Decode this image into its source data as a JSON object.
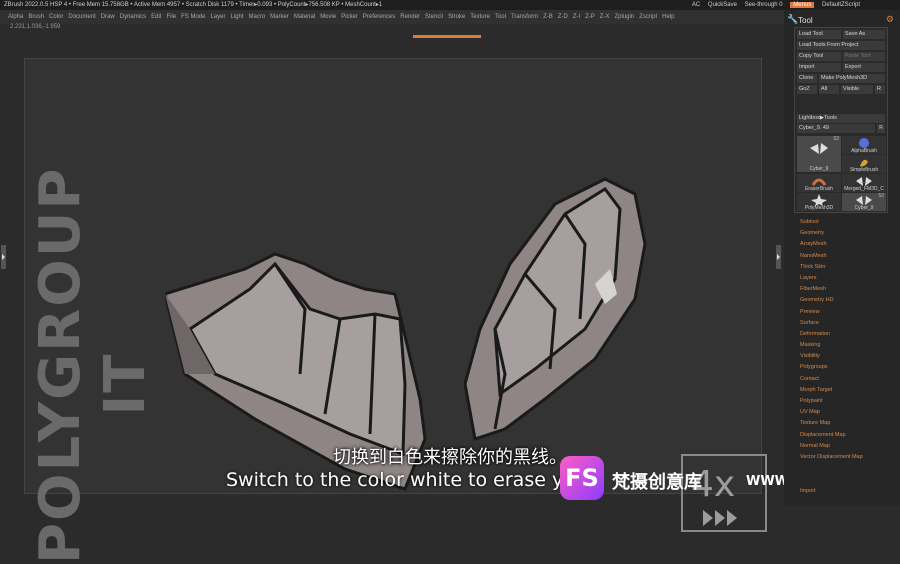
{
  "titlebar": {
    "left_text": "ZBrush 2022.0.5    HSP 4    • Free Mem 15.758GB • Active Mem 4957 • Scratch Disk 1179 •  Timer▸0.093 • PolyCount▸756.508 KP • MeshCount▸1",
    "ac": "AC",
    "quicksave": "QuickSave",
    "see_through": "See-through   0",
    "menus": "Menus",
    "default_script": "DefaultZScript"
  },
  "menubar": [
    "Alpha",
    "Brush",
    "Color",
    "Document",
    "Draw",
    "Dynamics",
    "Edit",
    "File",
    "FS Mode",
    "Layer",
    "Light",
    "Macro",
    "Marker",
    "Material",
    "Movie",
    "Picker",
    "Preferences",
    "Render",
    "Stencil",
    "Stroke",
    "Texture",
    "Tool",
    "Transform",
    "Z-B",
    "Z-D",
    "Z-I",
    "Z-P",
    "Z-X",
    "Zplugin",
    "Zscript",
    "Help"
  ],
  "coords": "2.231,1.036,-1.959",
  "canvas": {
    "vertical_text": "POLYGROUP IT",
    "speed_badge": "4x"
  },
  "subtitles": {
    "cn": "切换到白色来擦除你的黑线。",
    "en": "Switch to the color white to erase yo"
  },
  "watermark": {
    "logo": "FS",
    "cn": "梵摄创意库",
    "url": "WWW.FSTVC.CC"
  },
  "tool_panel": {
    "title": "Tool",
    "load_tool": "Load Tool",
    "save_as": "Save As",
    "load_from_project": "Load Tools From Project",
    "copy_tool": "Copy Tool",
    "paste_tool": "Paste Tool",
    "import": "Import",
    "export": "Export",
    "clone": "Clone",
    "make_polymesh": "Make PolyMesh3D",
    "goz": "GoZ",
    "all": "All",
    "visible": "Visible",
    "r": "R",
    "lightbox": "Lightbox▶Tools",
    "slider_label": "Cyber_9. 49",
    "slider_r": "R",
    "thumbs": [
      {
        "label": "Cyber_9",
        "count": "52"
      },
      {
        "label": "AlphaBrush",
        "count": ""
      },
      {
        "label": "SimpleBrush",
        "count": ""
      },
      {
        "label": "EraserBrush",
        "count": ""
      },
      {
        "label": "Merged_FM3D_C",
        "count": ""
      },
      {
        "label": "PolyMesh3D",
        "count": ""
      },
      {
        "label": "Cyber_9",
        "count": "52"
      }
    ],
    "subpalettes": [
      "Subtool",
      "Geometry",
      "ArrayMesh",
      "NanoMesh",
      "Thick Skin",
      "Layers",
      "FiberMesh",
      "Geometry HD",
      "Preview",
      "Surface",
      "Deformation",
      "Masking",
      "Visibility",
      "Polygroups",
      "Contact",
      "Morph Target",
      "Polypaint",
      "UV Map",
      "Texture Map",
      "Displacement Map",
      "Normal Map",
      "Vector Displacement Map",
      "",
      "",
      "Import"
    ]
  }
}
